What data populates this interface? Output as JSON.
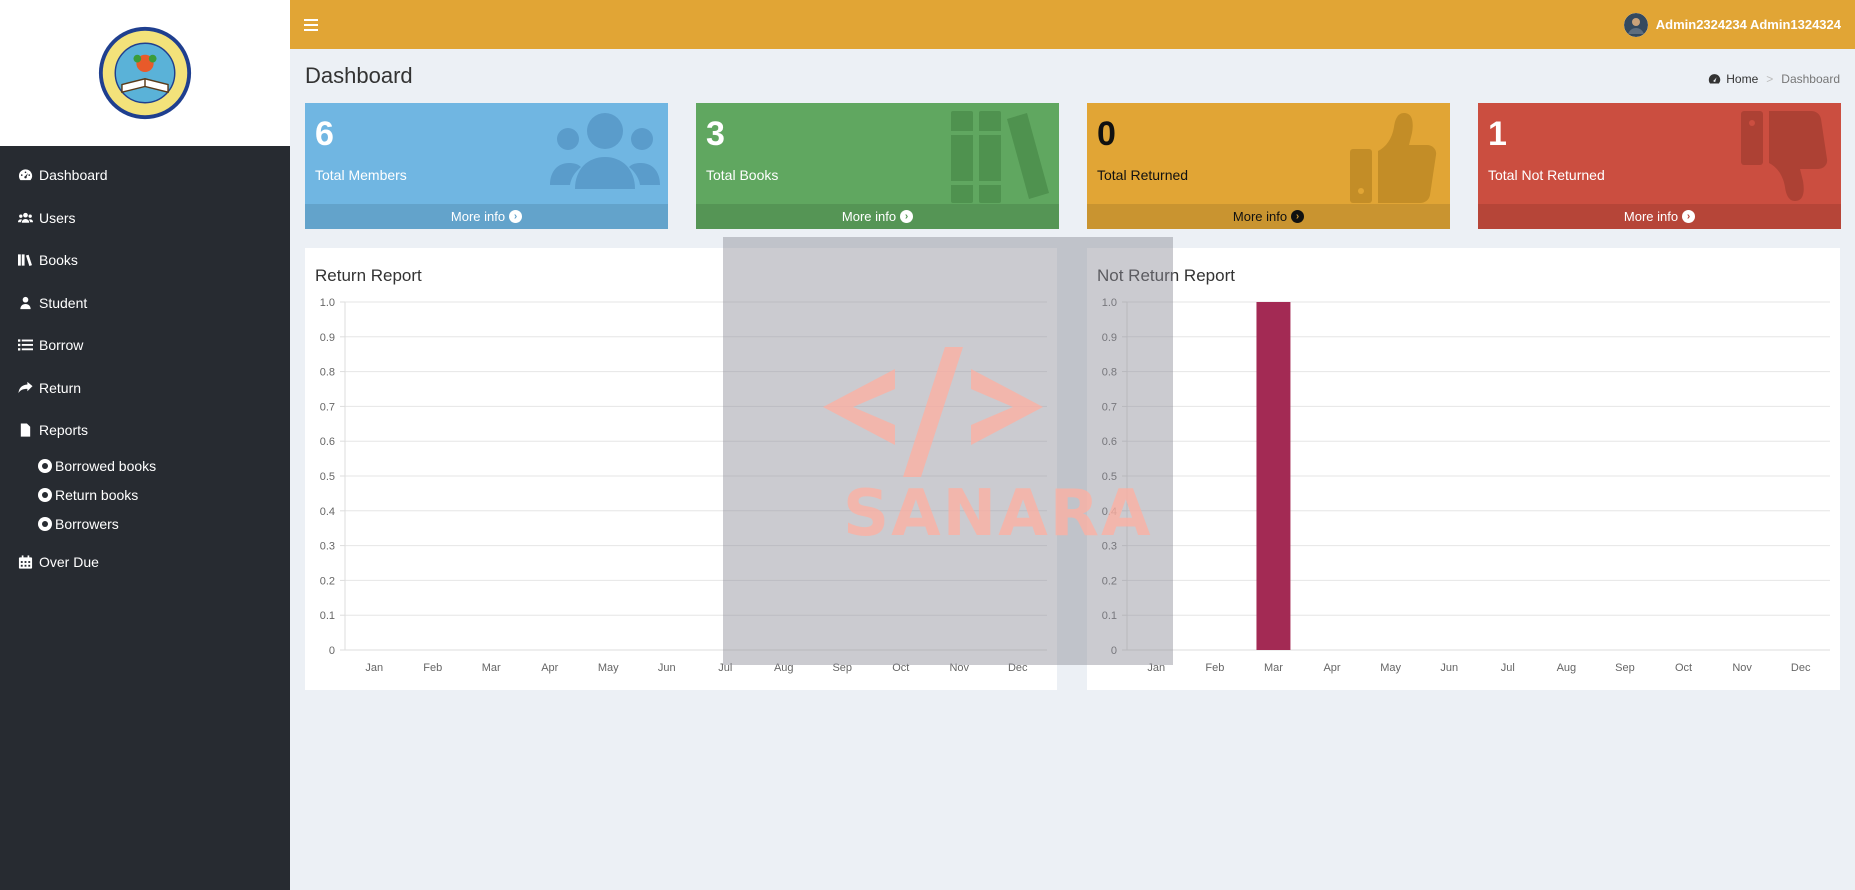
{
  "sidebar": {
    "logo_name": "school-logo",
    "items": [
      {
        "label": "Dashboard",
        "icon": "tachometer-icon"
      },
      {
        "label": "Users",
        "icon": "users-icon"
      },
      {
        "label": "Books",
        "icon": "books-icon"
      },
      {
        "label": "Student",
        "icon": "user-icon"
      },
      {
        "label": "Borrow",
        "icon": "list-icon"
      },
      {
        "label": "Return",
        "icon": "share-icon"
      },
      {
        "label": "Reports",
        "icon": "file-icon"
      }
    ],
    "reports_sub": [
      {
        "label": "Borrowed books"
      },
      {
        "label": "Return books"
      },
      {
        "label": "Borrowers"
      }
    ],
    "overdue": {
      "label": "Over Due",
      "icon": "calendar-icon"
    }
  },
  "header": {
    "user_name": "Admin2324234 Admin1324324"
  },
  "page": {
    "title": "Dashboard",
    "breadcrumb": {
      "home": "Home",
      "current": "Dashboard"
    }
  },
  "boxes": [
    {
      "count": "6",
      "label": "Total Members",
      "more": "More info",
      "icon": "users-icon"
    },
    {
      "count": "3",
      "label": "Total Books",
      "more": "More info",
      "icon": "books-icon"
    },
    {
      "count": "0",
      "label": "Total Returned",
      "more": "More info",
      "icon": "thumbs-up-icon"
    },
    {
      "count": "1",
      "label": "Total Not Returned",
      "more": "More info",
      "icon": "thumbs-down-icon"
    }
  ],
  "watermark": {
    "text": "SANARA"
  },
  "colors": {
    "sidebar": "#272b31",
    "header": "#e1a535",
    "blue": "#70b6e2",
    "green": "#60a760",
    "yellow": "#e1a535",
    "red": "#cb4e40",
    "bar": "#a32a54"
  },
  "chart_data": [
    {
      "type": "bar",
      "title": "Return Report",
      "categories": [
        "Jan",
        "Feb",
        "Mar",
        "Apr",
        "May",
        "Jun",
        "Jul",
        "Aug",
        "Sep",
        "Oct",
        "Nov",
        "Dec"
      ],
      "values": [
        0,
        0,
        0,
        0,
        0,
        0,
        0,
        0,
        0,
        0,
        0,
        0
      ],
      "yticks": [
        "0",
        "0.1",
        "0.2",
        "0.3",
        "0.4",
        "0.5",
        "0.6",
        "0.7",
        "0.8",
        "0.9",
        "1.0"
      ],
      "ylim": [
        0,
        1
      ],
      "grid": true
    },
    {
      "type": "bar",
      "title": "Not Return Report",
      "categories": [
        "Jan",
        "Feb",
        "Mar",
        "Apr",
        "May",
        "Jun",
        "Jul",
        "Aug",
        "Sep",
        "Oct",
        "Nov",
        "Dec"
      ],
      "values": [
        0,
        0,
        1,
        0,
        0,
        0,
        0,
        0,
        0,
        0,
        0,
        0
      ],
      "yticks": [
        "0",
        "0.1",
        "0.2",
        "0.3",
        "0.4",
        "0.5",
        "0.6",
        "0.7",
        "0.8",
        "0.9",
        "1.0"
      ],
      "ylim": [
        0,
        1
      ],
      "grid": true,
      "bar_color": "#a32a54"
    }
  ]
}
